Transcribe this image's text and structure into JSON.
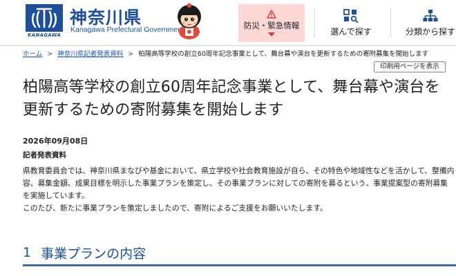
{
  "header": {
    "logo_title": "神奈川県",
    "logo_subtitle": "Kanagawa Prefectural Government",
    "logo_small": "KANAGAWA",
    "nav": {
      "disaster_label": "防災・緊急情報",
      "search_by_choice_label": "選んで探す",
      "search_by_category_label": "分類から探す"
    }
  },
  "breadcrumb": {
    "home": "ホーム",
    "separator": ">",
    "press_materials": "神奈川県記者発表資料",
    "current": "柏陽高等学校の創立60周年記念事業として、舞台幕や演台を更新するための寄附募集を開始します"
  },
  "print_button_label": "印刷用ページを表示",
  "page_title": "柏陽高等学校の創立60周年記念事業として、舞台幕や演台を更新するための寄附募集を開始します",
  "date": "2026年09月08日",
  "doc_type": "記者発表資料",
  "body": {
    "paragraph1": "県教育委員会では、神奈川県まなびや基金において、県立学校や社会教育施設が自ら、その特色や地域性などを活かして、整備内容、募集金額、成果目標を明示した事業プランを策定し、その事業プランに対しての寄附を募るという、事業提案型の寄附募集を実施しています。",
    "paragraph2": "このたび、新たに事業プランを策定しましたので、寄附によるご支援をお願いいたします。"
  },
  "section1": {
    "number": "1",
    "title": "事業プランの内容"
  },
  "colors": {
    "brand_blue": "#1d4f9c",
    "disaster_bg": "#fbd7d5",
    "alert_red": "#d93a3a",
    "link_blue": "#1d55c9"
  },
  "icons": {
    "disaster": "warning-triangle-icon",
    "search_choice": "grid-search-icon",
    "category": "hierarchy-icon"
  }
}
